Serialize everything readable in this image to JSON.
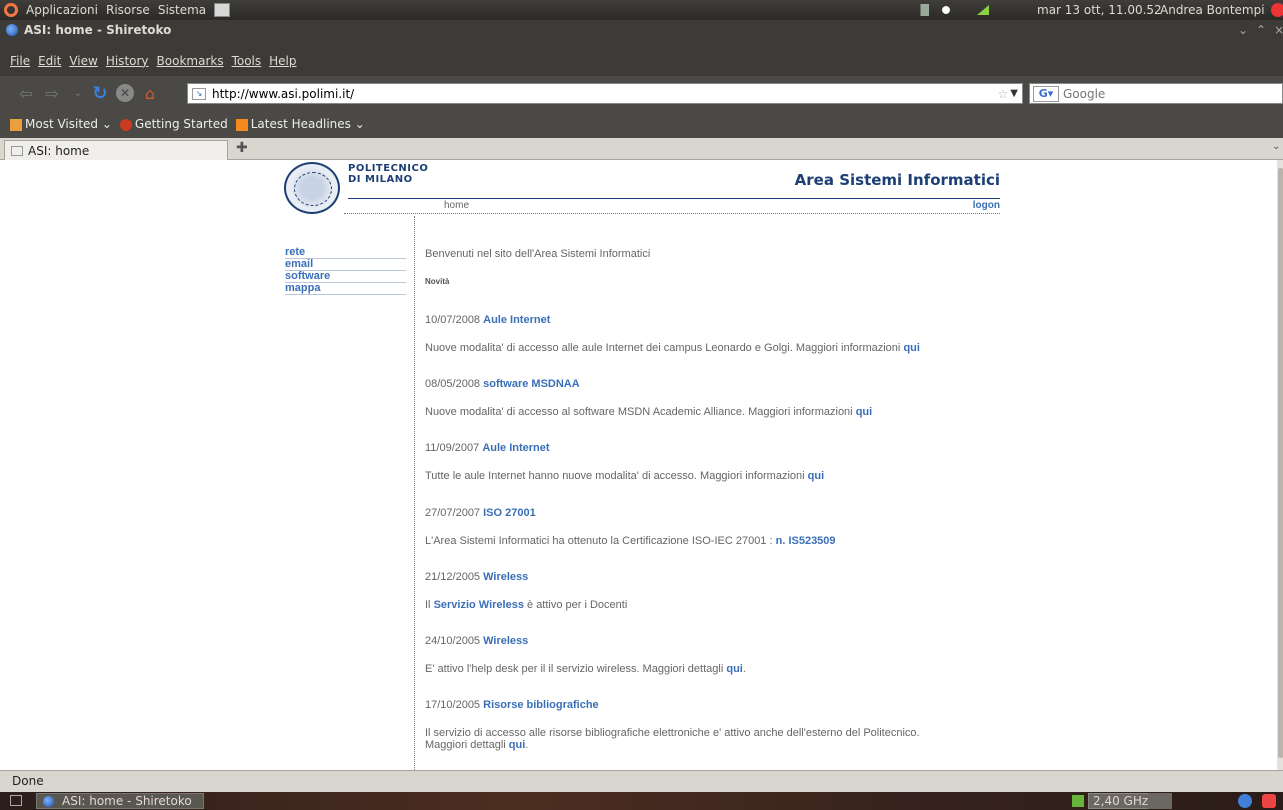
{
  "top_panel": {
    "menus": [
      "Applicazioni",
      "Risorse",
      "Sistema"
    ],
    "clock": "mar 13 ott, 11.00.52",
    "user": "Andrea Bontempi"
  },
  "window": {
    "title": "ASI: home - Shiretoko"
  },
  "menubar": [
    "File",
    "Edit",
    "View",
    "History",
    "Bookmarks",
    "Tools",
    "Help"
  ],
  "navbar": {
    "url": "http://www.asi.polimi.it/",
    "search_placeholder": "Google"
  },
  "bookmarks": [
    "Most Visited",
    "Getting Started",
    "Latest Headlines"
  ],
  "tabs": [
    {
      "label": "ASI: home"
    }
  ],
  "page": {
    "logo_line1": "POLITECNICO",
    "logo_line2": "DI MILANO",
    "site_title": "Area Sistemi Informatici",
    "subnav_home": "home",
    "subnav_logon": "logon",
    "left_nav": [
      "rete",
      "email",
      "software",
      "mappa"
    ],
    "welcome": "Benvenuti nel sito dell'Area Sistemi Informatici",
    "novita_label": "Novità",
    "news": [
      {
        "date": "10/07/2008",
        "title": "Aule Internet",
        "body": "Nuove modalita' di accesso alle aule Internet dei campus Leonardo e Golgi. Maggiori informazioni",
        "link": "qui",
        "tail": ""
      },
      {
        "date": "08/05/2008",
        "title": "software MSDNAA",
        "body": "Nuove modalita' di accesso al software MSDN Academic Alliance. Maggiori informazioni",
        "link": "qui",
        "tail": ""
      },
      {
        "date": "11/09/2007",
        "title": "Aule Internet",
        "body": "Tutte le aule Internet hanno nuove modalita' di accesso. Maggiori informazioni",
        "link": "qui",
        "tail": ""
      },
      {
        "date": "27/07/2007",
        "title": "ISO 27001",
        "body": "L'Area Sistemi Informatici ha ottenuto la Certificazione ISO-IEC 27001 :",
        "link": "n. IS523509",
        "tail": ""
      },
      {
        "date": "21/12/2005",
        "title": "Wireless",
        "body_pre": "Il",
        "link": "Servizio Wireless",
        "tail": "è attivo per i Docenti"
      },
      {
        "date": "24/10/2005",
        "title": "Wireless",
        "body": "E' attivo l'help desk per il il servizio wireless. Maggiori dettagli",
        "link": "qui",
        "tail": "."
      },
      {
        "date": "17/10/2005",
        "title": "Risorse bibliografiche",
        "body": "Il servizio di accesso alle risorse bibliografiche elettroniche e' attivo anche dell'esterno del Politecnico.",
        "body2": "Maggiori dettagli",
        "link": "qui",
        "tail": "."
      }
    ]
  },
  "status": "Done",
  "bottom_panel": {
    "task": "ASI: home - Shiretoko",
    "cpu_freq": "2,40 GHz"
  },
  "icons": {
    "system_logo": "ubuntu-logo-icon",
    "browser": "firefox-icon"
  }
}
